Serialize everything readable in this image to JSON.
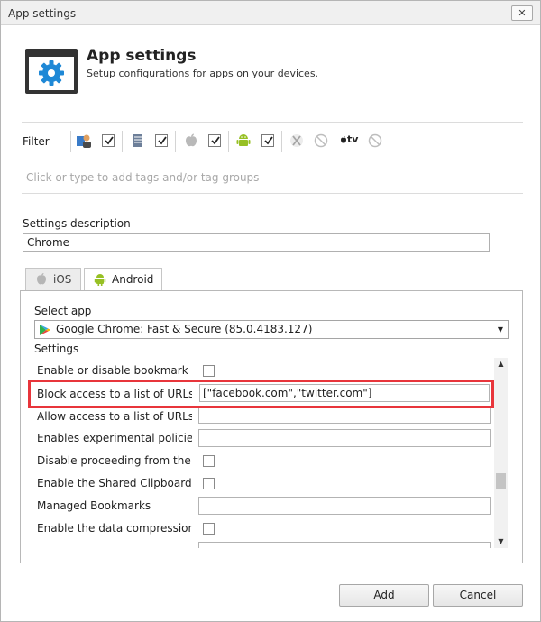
{
  "window": {
    "title": "App settings",
    "close_glyph": "✕"
  },
  "header": {
    "icon": "gear-icon",
    "title": "App settings",
    "subtitle": "Setup configurations for apps on your devices."
  },
  "filter": {
    "label": "Filter",
    "platforms": [
      {
        "name": "all-devices-icon",
        "checked": true
      },
      {
        "name": "windows-icon",
        "checked": true
      },
      {
        "name": "apple-icon",
        "checked": true
      },
      {
        "name": "android-icon",
        "checked": true
      },
      {
        "name": "xbox-icon",
        "disabled": true
      },
      {
        "name": "apple-tv-icon",
        "text": "tv",
        "disabled": true
      }
    ]
  },
  "tags": {
    "placeholder": "Click or type to add tags and/or tag groups"
  },
  "description": {
    "label": "Settings description",
    "value": "Chrome"
  },
  "tabs": [
    {
      "label": "iOS",
      "active": false
    },
    {
      "label": "Android",
      "active": true
    }
  ],
  "select_app": {
    "label": "Select app",
    "value": "Google Chrome: Fast & Secure (85.0.4183.127)"
  },
  "settings": {
    "label": "Settings",
    "rows": [
      {
        "label": "Enable or disable bookmark e...",
        "type": "checkbox"
      },
      {
        "label": "Block access to a list of URLs",
        "type": "text",
        "value": "[\"facebook.com\",\"twitter.com\"]",
        "highlighted": true
      },
      {
        "label": "Allow access to a list of URLs",
        "type": "text",
        "value": ""
      },
      {
        "label": "Enables experimental policies",
        "type": "text",
        "value": ""
      },
      {
        "label": "Disable proceeding from the ...",
        "type": "checkbox"
      },
      {
        "label": "Enable the Shared Clipboard ...",
        "type": "checkbox"
      },
      {
        "label": "Managed Bookmarks",
        "type": "text",
        "value": ""
      },
      {
        "label": "Enable the data compression ...",
        "type": "checkbox"
      },
      {
        "label": "",
        "type": "text",
        "value": ""
      }
    ]
  },
  "colors": {
    "highlight": "#e8353b",
    "android": "#97c024",
    "gear": "#1e88d6"
  },
  "buttons": {
    "add": "Add",
    "cancel": "Cancel"
  }
}
